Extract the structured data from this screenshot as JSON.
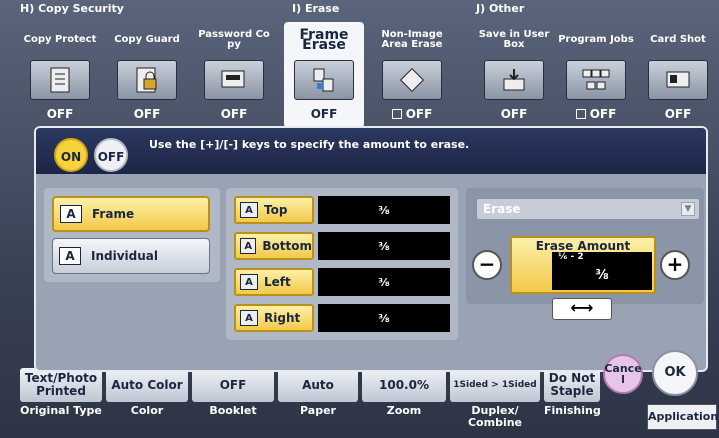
{
  "groups": {
    "h": "H)  Copy Security",
    "i": "I)   Erase",
    "j": "J)   Other"
  },
  "functions": [
    {
      "label": "Copy Protect",
      "state": "OFF",
      "icon": "copy-protect-icon"
    },
    {
      "label": "Copy Guard",
      "state": "OFF",
      "icon": "copy-guard-icon"
    },
    {
      "label": "Password Co py",
      "state": "OFF",
      "icon": "password-copy-icon"
    },
    {
      "label": "Frame Erase",
      "state": "OFF",
      "icon": "frame-erase-icon"
    },
    {
      "label": "Non-Image Area Erase",
      "state": "OFF",
      "icon": "non-image-erase-icon"
    },
    {
      "label": "Save in User Box",
      "state": "OFF",
      "icon": "save-box-icon"
    },
    {
      "label": "Program Jobs",
      "state": "OFF",
      "icon": "program-jobs-icon"
    },
    {
      "label": "Card Shot",
      "state": "OFF",
      "icon": "card-shot-icon"
    }
  ],
  "dialog": {
    "on_label": "ON",
    "off_label": "OFF",
    "instruction": "Use the [+]/[-] keys to specify the amount to erase.",
    "modes": [
      {
        "label": "Frame",
        "selected": true
      },
      {
        "label": "Individual",
        "selected": false
      }
    ],
    "edges": [
      {
        "label": "Top",
        "value": "⅜"
      },
      {
        "label": "Bottom",
        "value": "⅜"
      },
      {
        "label": "Left",
        "value": "⅜"
      },
      {
        "label": "Right",
        "value": "⅜"
      }
    ],
    "erase_select": "Erase",
    "amount_title": "Erase Amount",
    "amount_range": "⅙ - 2",
    "amount_value": "⅜",
    "minus": "−",
    "plus": "+",
    "toggle_arrow": "⟷"
  },
  "bottom": [
    {
      "value": "Text/Photo Printed",
      "label": "Original Type"
    },
    {
      "value": "Auto Color",
      "label": "Color"
    },
    {
      "value": "OFF",
      "label": "Booklet"
    },
    {
      "value": "Auto",
      "label": "Paper"
    },
    {
      "value": "100.0%",
      "label": "Zoom"
    },
    {
      "value": "1Sided > 1Sided",
      "label": "Duplex/ Combine"
    },
    {
      "value": "Do Not Staple",
      "label": "Finishing"
    }
  ],
  "cancel_label": "Cance l",
  "ok_label": "OK",
  "application_label": "Application"
}
